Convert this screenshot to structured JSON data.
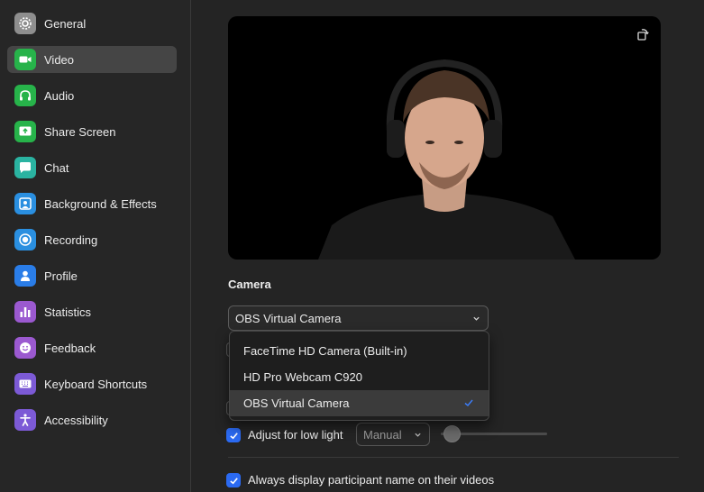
{
  "sidebar": {
    "items": [
      {
        "label": "General",
        "icon": "gear-icon",
        "color": "#8e8e8e"
      },
      {
        "label": "Video",
        "icon": "video-camera-icon",
        "color": "#27b34a",
        "active": true
      },
      {
        "label": "Audio",
        "icon": "headphones-icon",
        "color": "#27b34a"
      },
      {
        "label": "Share Screen",
        "icon": "share-screen-icon",
        "color": "#27b34a"
      },
      {
        "label": "Chat",
        "icon": "chat-icon",
        "color": "#2ab3a1"
      },
      {
        "label": "Background & Effects",
        "icon": "background-icon",
        "color": "#2a8fe0"
      },
      {
        "label": "Recording",
        "icon": "recording-icon",
        "color": "#2a8fe0"
      },
      {
        "label": "Profile",
        "icon": "profile-icon",
        "color": "#2a7de8"
      },
      {
        "label": "Statistics",
        "icon": "statistics-icon",
        "color": "#9b59d0"
      },
      {
        "label": "Feedback",
        "icon": "feedback-icon",
        "color": "#9b59d0"
      },
      {
        "label": "Keyboard Shortcuts",
        "icon": "keyboard-icon",
        "color": "#7c5ad6"
      },
      {
        "label": "Accessibility",
        "icon": "accessibility-icon",
        "color": "#7c5ad6"
      }
    ]
  },
  "camera": {
    "section_title": "Camera",
    "selected": "OBS Virtual Camera",
    "options": [
      "FaceTime HD Camera (Built-in)",
      "HD Pro Webcam C920",
      "OBS Virtual Camera"
    ],
    "selected_index": 2
  },
  "options": {
    "low_light_label": "Adjust for low light",
    "low_light_mode": "Manual",
    "low_light_slider_level": 0.05,
    "name_display_label": "Always display participant name on their videos"
  },
  "colors": {
    "accent": "#2b6af2",
    "background": "#242424",
    "sidebar_active": "#454545"
  }
}
